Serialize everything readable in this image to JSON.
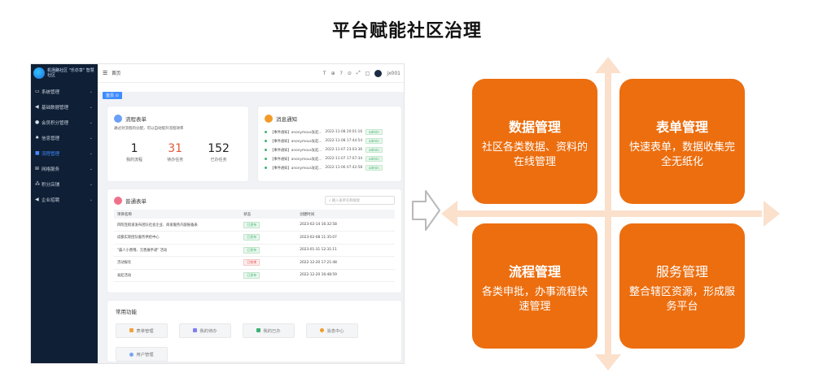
{
  "slide": {
    "title": "平台赋能社区治理"
  },
  "app": {
    "logo_text": "机场路社区 \"乐亦享\" 智慧社区",
    "sidebar": [
      {
        "label": "系统管理",
        "icon": "monitor-icon"
      },
      {
        "label": "基础数据管理",
        "icon": "send-icon"
      },
      {
        "label": "会员积分管理",
        "icon": "user-icon"
      },
      {
        "label": "信息管理",
        "icon": "bell-icon"
      },
      {
        "label": "流程管理",
        "icon": "doc-icon",
        "active": true
      },
      {
        "label": "网格服务",
        "icon": "grid-icon"
      },
      {
        "label": "积分店铺",
        "icon": "network-icon"
      },
      {
        "label": "企业招聘",
        "icon": "send-icon"
      }
    ],
    "topbar": {
      "breadcrumb": "首页",
      "username": "jx001"
    },
    "tab_label": "首页 ⊙",
    "flow_card": {
      "title": "流程表单",
      "desc": "通过对流程的分配，可以自动提升流程效率",
      "stats": [
        {
          "num": "1",
          "label": "我的流程"
        },
        {
          "num": "31",
          "label": "待办任务"
        },
        {
          "num": "152",
          "label": "已办任务"
        }
      ]
    },
    "notice_card": {
      "title": "消息通知",
      "items": [
        {
          "text": "【事件通知】anonymous发起...",
          "time": "2022-11-08 20:01:16",
          "tag": "admin"
        },
        {
          "text": "【事件通知】anonymous发起...",
          "time": "2022-11-08 17:44:54",
          "tag": "admin"
        },
        {
          "text": "【事件通知】anonymous发起...",
          "time": "2022-11-07 23:03:36",
          "tag": "admin"
        },
        {
          "text": "【事件通知】anonymous发起...",
          "time": "2022-11-07 17:07:34",
          "tag": "admin"
        },
        {
          "text": "【事件通知】anonymous发起...",
          "time": "2022-11-06 07:42:58",
          "tag": "admin"
        }
      ]
    },
    "form_card": {
      "title": "普通表单",
      "search_placeholder": "输入表单名称搜索",
      "columns": [
        "项目名称",
        "状态",
        "创建时间"
      ],
      "rows": [
        {
          "name": "四院连街道发布团队社会企业、商家服务内容报备表",
          "status": "已发布",
          "status_type": "ok",
          "time": "2023-02-14 16:32:58"
        },
        {
          "name": "成都实际团队服务供给中心",
          "status": "已发布",
          "status_type": "ok",
          "time": "2023-02-08 11:35:07"
        },
        {
          "name": "\"晨人小善哦、元善展手递\" 活动",
          "status": "已发布",
          "status_type": "ok",
          "time": "2023-01-31 12:31:11"
        },
        {
          "name": "活动报名",
          "status": "已结束",
          "status_type": "bad",
          "time": "2022-12-20 17:21:48"
        },
        {
          "name": "发起活动",
          "status": "已发布",
          "status_type": "ok",
          "time": "2022-12-20 16:48:59"
        }
      ]
    },
    "quick_card": {
      "title": "常用功能",
      "buttons": [
        {
          "label": "表单管理",
          "color": "#f2a23c"
        },
        {
          "label": "我的待办",
          "color": "#7f7ff0"
        },
        {
          "label": "我的已办",
          "color": "#3cb371"
        },
        {
          "label": "消息中心",
          "color": "#f39b2a"
        },
        {
          "label": "用户管理",
          "color": "#7aa4f0"
        }
      ]
    }
  },
  "quadrants": [
    {
      "title": "数据管理",
      "desc": "社区各类数据、资料的在线管理"
    },
    {
      "title": "表单管理",
      "desc": "快速表单，数据收集完全无纸化"
    },
    {
      "title": "流程管理",
      "desc": "各类申批，办事流程快速管理"
    },
    {
      "title": "服务管理",
      "desc": "整合辖区资源，形成服务平台"
    }
  ],
  "colors": {
    "orange": "#ec6e0f",
    "sidebar": "#0f1f35",
    "accent": "#3f8cff"
  }
}
